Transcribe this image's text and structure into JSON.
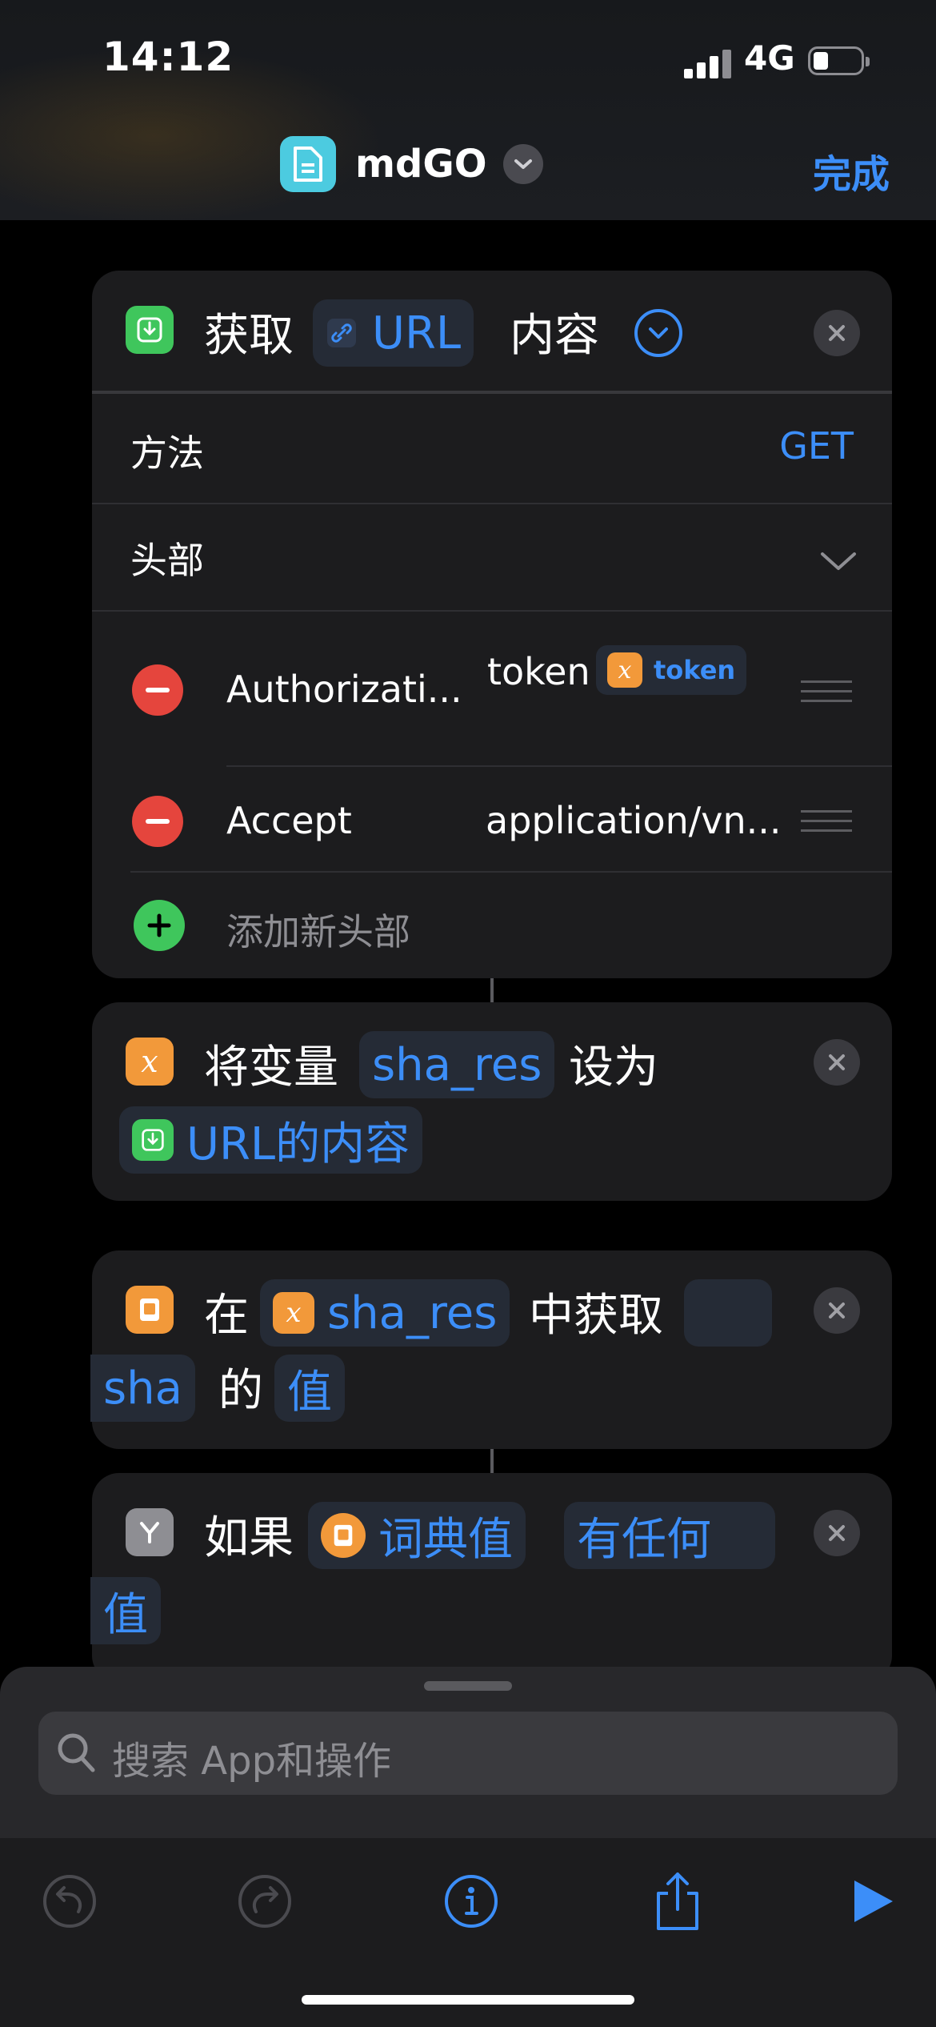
{
  "status": {
    "time": "14:12",
    "network": "4G"
  },
  "nav": {
    "title": "mdGO",
    "done_label": "完成",
    "app_icon": "document-icon"
  },
  "card_get_url": {
    "word_get": "获取",
    "token_url": "URL",
    "word_content": "内容",
    "method_label": "方法",
    "method_value": "GET",
    "headers_label": "头部",
    "headers": [
      {
        "key": "Authorizati...",
        "value_text": "token",
        "value_var": "token"
      },
      {
        "key": "Accept",
        "value_text": "application/vn..."
      }
    ],
    "add_header_label": "添加新头部"
  },
  "card_set_var": {
    "word_set": "将变量",
    "token_var": "sha_res",
    "word_to": "设为",
    "token_value": "URL的内容"
  },
  "card_get_dict": {
    "word_in": "在",
    "token_dict": "sha_res",
    "word_get": "中获取",
    "token_key": "sha",
    "word_of": "的",
    "token_value": "值"
  },
  "card_if": {
    "word_if": "如果",
    "token_input": "词典值",
    "token_condition": "有任何",
    "token_condition_cont": "值"
  },
  "sheet": {
    "search_placeholder": "搜索 App和操作"
  },
  "colors": {
    "accent": "#3c8ef8",
    "card_bg": "#1c1c1e",
    "green": "#3fc65c",
    "orange": "#f2993a",
    "red": "#e5453d"
  }
}
